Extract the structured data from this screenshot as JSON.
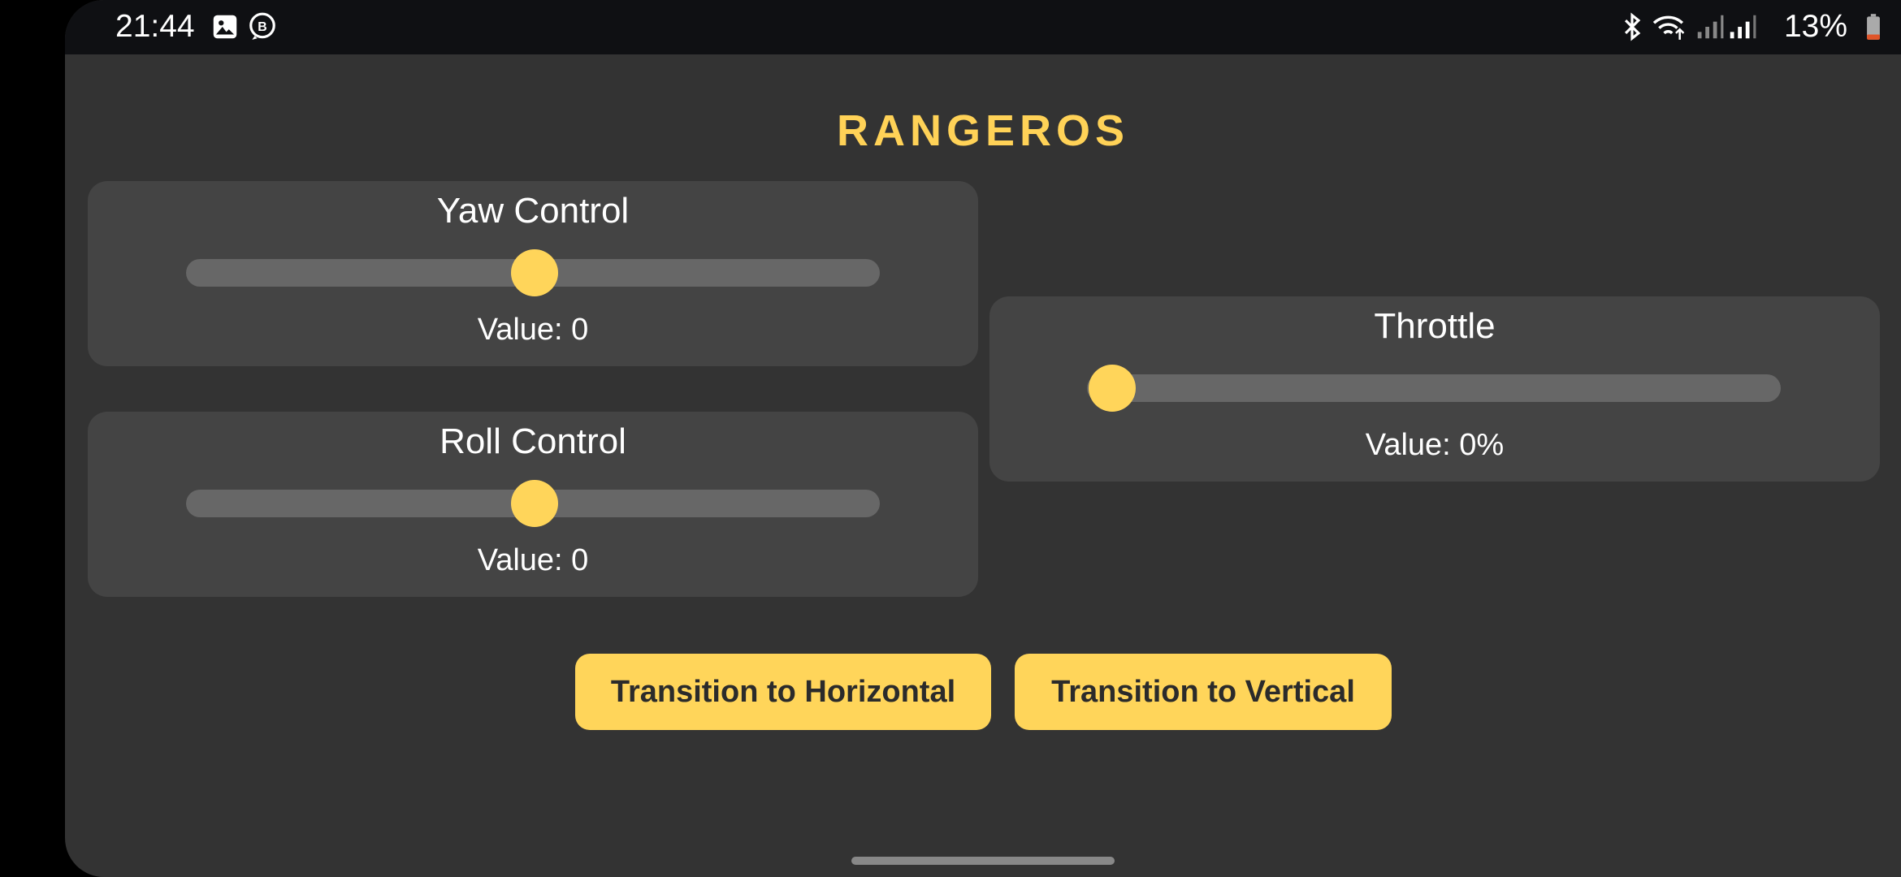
{
  "status_bar": {
    "time": "21:44",
    "left_icons": [
      "image-icon",
      "b-circle-icon"
    ],
    "right_icons": [
      "bluetooth-icon",
      "wifi-icon",
      "signal-icon",
      "signal-icon"
    ],
    "battery_percent": "13%"
  },
  "app": {
    "title": "RANGEROS",
    "accent_color": "#ffd55a"
  },
  "controls": {
    "yaw": {
      "label": "Yaw Control",
      "value_text": "Value: 0",
      "position": 0.5
    },
    "roll": {
      "label": "Roll Control",
      "value_text": "Value: 0",
      "position": 0.5
    },
    "throttle": {
      "label": "Throttle",
      "value_text": "Value: 0%",
      "position": 0.0
    }
  },
  "buttons": {
    "horizontal": "Transition to Horizontal",
    "vertical": "Transition to Vertical"
  }
}
